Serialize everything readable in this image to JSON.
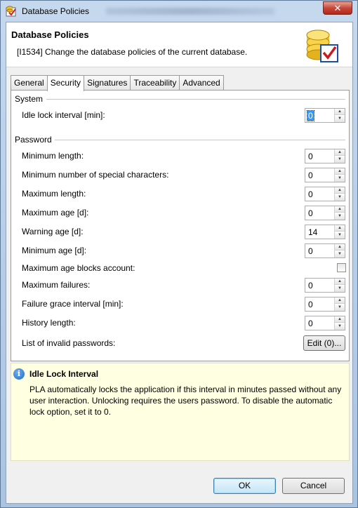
{
  "window": {
    "title": "Database Policies",
    "close_glyph": "✕"
  },
  "header": {
    "title": "Database Policies",
    "description": "[I1534] Change the database policies of the current database.",
    "icon": "database-check-icon"
  },
  "tabs": [
    {
      "label": "General",
      "active": false
    },
    {
      "label": "Security",
      "active": true
    },
    {
      "label": "Signatures",
      "active": false
    },
    {
      "label": "Traceability",
      "active": false
    },
    {
      "label": "Advanced",
      "active": false
    }
  ],
  "system": {
    "title": "System",
    "idle_lock": {
      "label": "Idle lock interval [min]:",
      "value": "0"
    }
  },
  "password": {
    "title": "Password",
    "min_length": {
      "label": "Minimum length:",
      "value": "0"
    },
    "min_special": {
      "label": "Minimum number of special characters:",
      "value": "0"
    },
    "max_length": {
      "label": "Maximum length:",
      "value": "0"
    },
    "max_age": {
      "label": "Maximum age [d]:",
      "value": "0"
    },
    "warning_age": {
      "label": "Warning age [d]:",
      "value": "14"
    },
    "min_age": {
      "label": "Minimum age [d]:",
      "value": "0"
    },
    "max_age_blocks": {
      "label": "Maximum age blocks account:",
      "checked": false
    },
    "max_failures": {
      "label": "Maximum failures:",
      "value": "0"
    },
    "failure_grace": {
      "label": "Failure grace interval [min]:",
      "value": "0"
    },
    "history_length": {
      "label": "History length:",
      "value": "0"
    },
    "invalid_passwords": {
      "label": "List of invalid passwords:",
      "button": "Edit (0)..."
    }
  },
  "info": {
    "title": "Idle Lock Interval",
    "text": "PLA automatically locks the application if this interval in minutes passed without any user interaction. Unlocking requires the users password. To disable the automatic lock option, set it to 0.",
    "icon_glyph": "i"
  },
  "buttons": {
    "ok": "OK",
    "cancel": "Cancel"
  },
  "spinner_glyphs": {
    "up": "▲",
    "down": "▼"
  }
}
